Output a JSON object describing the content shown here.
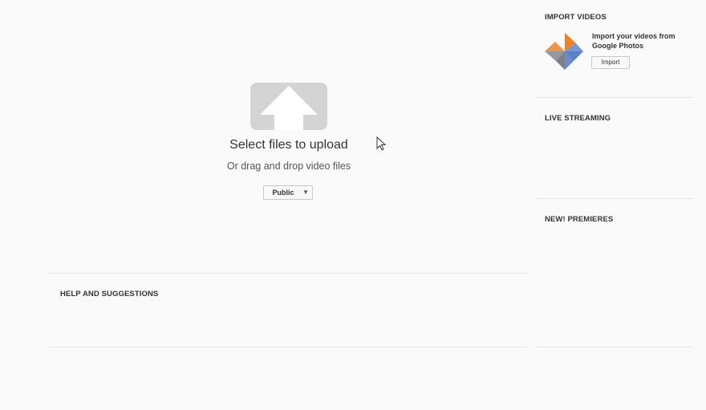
{
  "upload": {
    "title": "Select files to upload",
    "subtitle": "Or drag and drop video files",
    "privacy_value": "Public",
    "upload_icon": "upload-arrow-icon"
  },
  "help": {
    "title": "HELP AND SUGGESTIONS"
  },
  "sidebar": {
    "import_videos": {
      "title": "IMPORT VIDEOS",
      "description": "Import your videos from Google Photos",
      "button_label": "Import",
      "icon": "google-photos-icon"
    },
    "live_streaming": {
      "title": "LIVE STREAMING"
    },
    "premieres": {
      "title": "NEW! PREMIERES"
    }
  },
  "colors": {
    "background": "#fafafa",
    "upload_icon_bg": "#d4d4d4",
    "divider": "#e6e6e6",
    "photos_orange": "#e8822d",
    "photos_blue": "#5b80c3",
    "photos_gray": "#7a7f8a"
  }
}
